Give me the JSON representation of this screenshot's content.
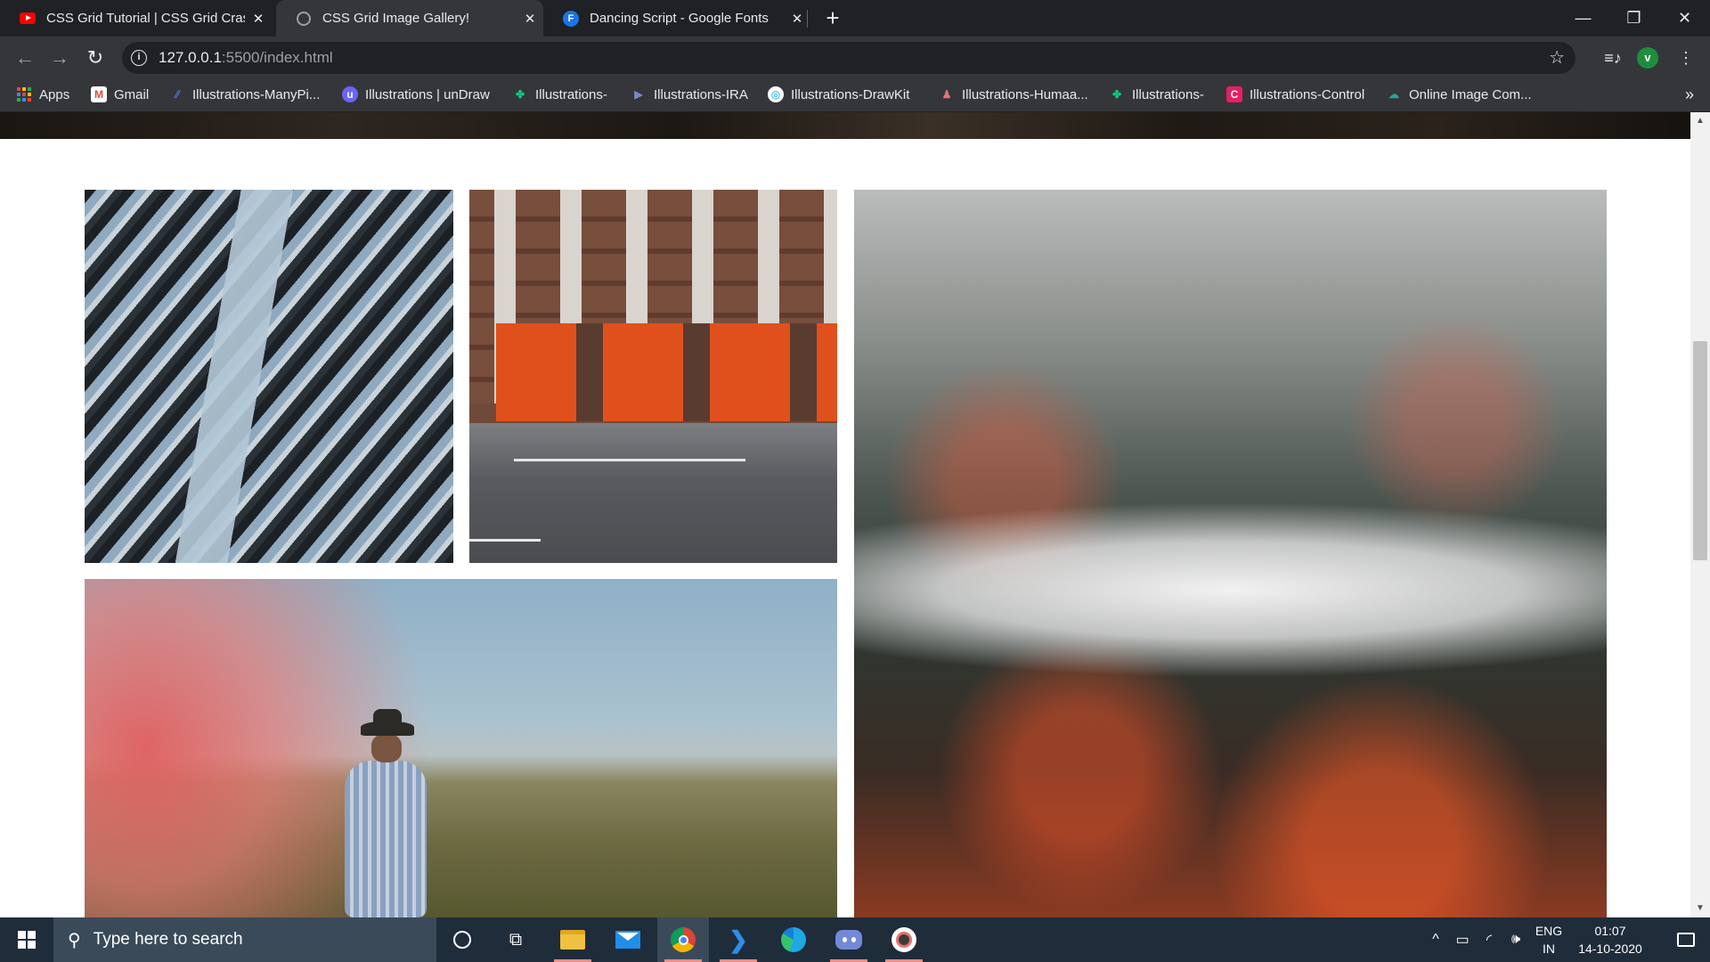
{
  "browser": {
    "tabs": [
      {
        "title": "CSS Grid Tutorial | CSS Grid Crash Course",
        "icon": "youtube-icon",
        "active": false
      },
      {
        "title": "CSS Grid Image Gallery!",
        "icon": "globe-icon",
        "active": true
      },
      {
        "title": "Dancing Script - Google Fonts",
        "icon": "google-fonts-icon",
        "active": false
      }
    ],
    "new_tab_label": "+",
    "window_controls": {
      "minimize": "—",
      "restore": "❐",
      "close": "✕"
    },
    "address": {
      "host": "127.0.0.1",
      "rest": ":5500/index.html"
    },
    "profile_initial": "v",
    "bookmarks": [
      {
        "label": "Apps",
        "icon": "apps-grid-icon"
      },
      {
        "label": "Gmail",
        "icon": "gmail-icon",
        "color": "#ea4335"
      },
      {
        "label": "Illustrations-ManyPi...",
        "icon": "manypixels-icon",
        "color": "#4a7be8"
      },
      {
        "label": "Illustrations | unDraw",
        "icon": "undraw-icon",
        "color": "#6c63ff"
      },
      {
        "label": "Illustrations-",
        "icon": "figma-icon",
        "color": "#0acf83"
      },
      {
        "label": "Illustrations-IRA",
        "icon": "ira-icon",
        "color": "#5c6bc0"
      },
      {
        "label": "Illustrations-DrawKit",
        "icon": "drawkit-icon",
        "color": "#4fc3f7"
      },
      {
        "label": "Illustrations-Humaa...",
        "icon": "humaaans-icon",
        "color": "#e57373"
      },
      {
        "label": "Illustrations-",
        "icon": "figma-icon",
        "color": "#0acf83"
      },
      {
        "label": "Illustrations-Control",
        "icon": "control-icon",
        "color": "#e91e63"
      },
      {
        "label": "Online Image Com...",
        "icon": "image-compressor-icon",
        "color": "#26a69a"
      }
    ],
    "bookmarks_more": "»"
  },
  "gallery": {
    "images": [
      {
        "name": "building-facade-image",
        "alt": "Building facade"
      },
      {
        "name": "fire-station-image",
        "alt": "Fire station with cyclist"
      },
      {
        "name": "forest-clouds-image",
        "alt": "Forest with clouds"
      },
      {
        "name": "red-smoke-man-image",
        "alt": "Man walking through red smoke"
      }
    ]
  },
  "taskbar": {
    "search_placeholder": "Type here to search",
    "apps": [
      "cortana-icon",
      "task-view-icon",
      "file-explorer-icon",
      "mail-icon",
      "chrome-icon",
      "vscode-icon",
      "edge-icon",
      "discord-icon",
      "obs-icon"
    ],
    "language": {
      "line1": "ENG",
      "line2": "IN"
    },
    "clock": {
      "time": "01:07",
      "date": "14-10-2020"
    }
  }
}
